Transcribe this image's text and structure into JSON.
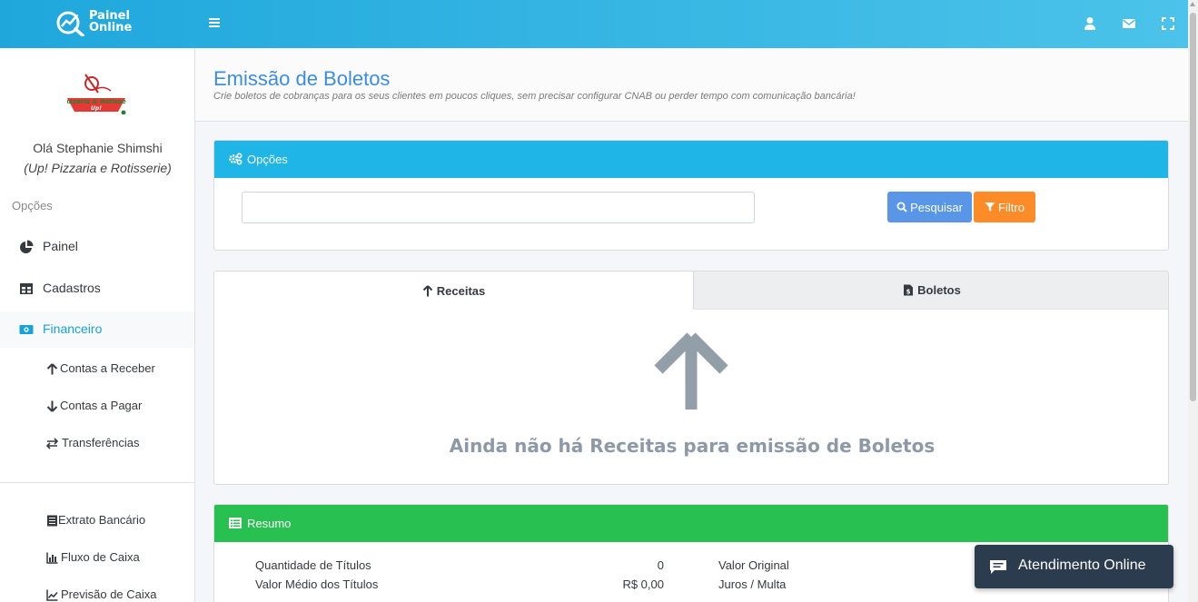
{
  "app": {
    "logo_line1": "Painel",
    "logo_line2": "Online"
  },
  "user": {
    "greeting": "Olá Stephanie Shimshi",
    "company": "(Up! Pizzaria e Rotisserie)"
  },
  "sidebar": {
    "section_label": "Opções",
    "items": [
      {
        "label": "Painel",
        "icon": "pie-chart-icon"
      },
      {
        "label": "Cadastros",
        "icon": "table-icon"
      },
      {
        "label": "Financeiro",
        "icon": "money-icon",
        "active": true
      }
    ],
    "finance_subitems": [
      {
        "label": "Contas a Receber",
        "icon": "arrow-up-icon"
      },
      {
        "label": "Contas a Pagar",
        "icon": "arrow-down-icon"
      },
      {
        "label": "Transferências",
        "icon": "exchange-icon"
      }
    ],
    "report_subitems": [
      {
        "label": "Extrato Bancário",
        "icon": "list-icon"
      },
      {
        "label": "Fluxo de Caixa",
        "icon": "bar-chart-icon"
      },
      {
        "label": "Previsão de Caixa",
        "icon": "line-chart-icon"
      }
    ]
  },
  "page": {
    "title": "Emissão de Boletos",
    "subtitle": "Crie boletos de cobranças para os seus clientes em poucos cliques, sem precisar configurar CNAB ou perder tempo com comunicação bancária!"
  },
  "options_card": {
    "title": "Opções",
    "search_value": "",
    "search_button": "Pesquisar",
    "filter_button": "Filtro"
  },
  "tabs": {
    "receitas": "Receitas",
    "boletos": "Boletos",
    "active": "receitas",
    "empty_message": "Ainda não há Receitas para emissão de Boletos"
  },
  "summary": {
    "title": "Resumo",
    "left": [
      {
        "label": "Quantidade de Títulos",
        "value": "0"
      },
      {
        "label": "Valor Médio dos Títulos",
        "value": "R$ 0,00"
      }
    ],
    "right": [
      {
        "label": "Valor Original"
      },
      {
        "label": "Juros / Multa"
      }
    ]
  },
  "chat": {
    "label": "Atendimento Online"
  },
  "colors": {
    "topbar": "#1fa7dc",
    "primary": "#3c8dde",
    "options_header": "#1fb5e6",
    "summary_header": "#28c050",
    "search_button": "#5a96e8",
    "filter_button": "#fd8c28",
    "chat": "#2b3c4e"
  }
}
